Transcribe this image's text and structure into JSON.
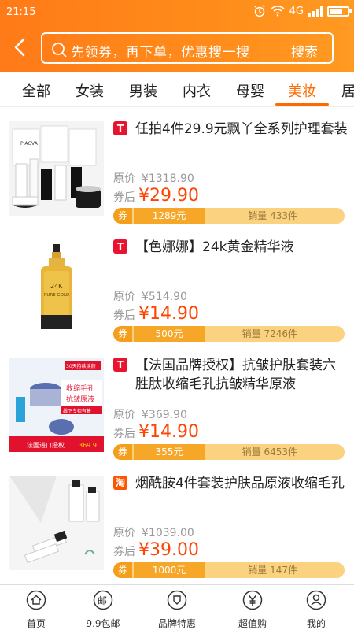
{
  "status": {
    "time": "21:15",
    "network": "4G"
  },
  "search": {
    "placeholder": "先领券，再下单，优惠搜一搜",
    "button": "搜索"
  },
  "tabs": [
    {
      "label": "全部"
    },
    {
      "label": "女装"
    },
    {
      "label": "男装"
    },
    {
      "label": "内衣"
    },
    {
      "label": "母婴"
    },
    {
      "label": "美妆",
      "active": true
    },
    {
      "label": "居"
    }
  ],
  "products": [
    {
      "source": "T",
      "source_type": "tmall",
      "title": "任拍4件29.9元飘丫全系列护理套装",
      "orig_label": "原价",
      "orig_price": "¥1318.90",
      "after_label": "券后",
      "after_price": "¥29.90",
      "coupon_tag": "券",
      "coupon_amount": "1289元",
      "sales": "销量 433件"
    },
    {
      "source": "T",
      "source_type": "tmall",
      "title": "【色娜娜】24k黄金精华液",
      "orig_label": "原价",
      "orig_price": "¥514.90",
      "after_label": "券后",
      "after_price": "¥14.90",
      "coupon_tag": "券",
      "coupon_amount": "500元",
      "sales": "销量 7246件"
    },
    {
      "source": "T",
      "source_type": "tmall",
      "title": "【法国品牌授权】抗皱护肤套装六胜肽收缩毛孔抗皱精华原液",
      "orig_label": "原价",
      "orig_price": "¥369.90",
      "after_label": "券后",
      "after_price": "¥14.90",
      "coupon_tag": "券",
      "coupon_amount": "355元",
      "sales": "销量 6453件"
    },
    {
      "source": "淘",
      "source_type": "taobao",
      "title": "烟酰胺4件套装护肤品原液收缩毛孔",
      "orig_label": "原价",
      "orig_price": "¥1039.00",
      "after_label": "券后",
      "after_price": "¥39.00",
      "coupon_tag": "券",
      "coupon_amount": "1000元",
      "sales": "销量 147件"
    }
  ],
  "images": {
    "p1_brand": "PIAGVA",
    "p2_label_1": "24K",
    "p2_label_2": "PURE GOLD",
    "p3_tag": "30天持续焕颜",
    "p3_text_1": "收缩毛孔",
    "p3_text_2": "抗皱原液",
    "p3_badge": "线下专柜有售",
    "p3_banner": "法国进口授权",
    "p3_price": "369.9"
  },
  "bottom_nav": [
    {
      "label": "首页",
      "icon": "home-icon"
    },
    {
      "label": "9.9包邮",
      "icon": "mail-icon"
    },
    {
      "label": "品牌特惠",
      "icon": "brand-icon"
    },
    {
      "label": "超值购",
      "icon": "yen-icon"
    },
    {
      "label": "我的",
      "icon": "user-icon"
    }
  ],
  "colors": {
    "accent": "#ff6a00",
    "header": "#ff8c1a",
    "price": "#ff4400",
    "bar": "#fbd280"
  }
}
